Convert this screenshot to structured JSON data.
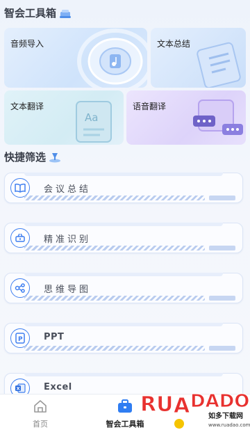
{
  "header": {
    "title": "智会工具箱"
  },
  "tools": [
    {
      "label": "音频导入"
    },
    {
      "label": "文本总结"
    },
    {
      "label": "文本翻译"
    },
    {
      "label": "语音翻译"
    }
  ],
  "filters_section": {
    "title": "快捷筛选"
  },
  "filters": [
    {
      "label": "会议总结",
      "icon": "book-icon"
    },
    {
      "label": "精准识别",
      "icon": "basket-icon"
    },
    {
      "label": "思维导图",
      "icon": "mindmap-icon"
    },
    {
      "label": "PPT",
      "icon": "ppt-icon"
    },
    {
      "label": "Excel",
      "icon": "excel-icon"
    }
  ],
  "bottom_nav": {
    "home_label": "首页",
    "toolbox_label": "智会工具箱"
  },
  "watermark": {
    "brand": "RUANDADO",
    "sub": "如多下载网",
    "url": "www.ruadao.com"
  },
  "colors": {
    "accent": "#3f7ff0",
    "card_blue": "#cfe3fb",
    "card_purple": "#e3dcfb"
  }
}
